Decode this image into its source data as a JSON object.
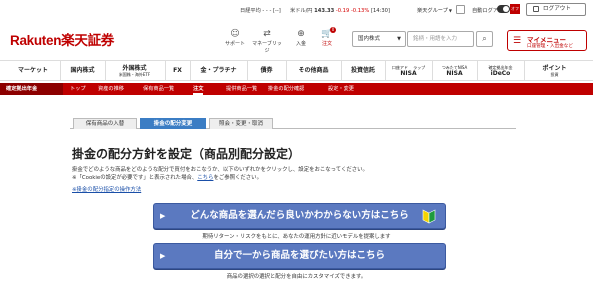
{
  "topbar": {
    "ticker": "日経平均 - - - [--]",
    "usd_label": "米ドル/円",
    "usd_value": "143.33",
    "usd_change": "-0.19",
    "usd_pct": "-0.13%",
    "usd_time": "[14:30]",
    "group": "楽天グループ",
    "autologin": "自動ログアウト",
    "toggle_label": "オフ",
    "logout": "ログアウト"
  },
  "brand": {
    "latin": "Rakuten",
    "kanji": "楽天証券"
  },
  "header_icons": [
    {
      "name": "support-icon",
      "glyph": "☺",
      "label": "サポート"
    },
    {
      "name": "bridge-icon",
      "glyph": "⇄",
      "label": "マネーブリッジ"
    },
    {
      "name": "deposit-icon",
      "glyph": "⊕",
      "label": "入金"
    },
    {
      "name": "cart-icon",
      "glyph": "🛒",
      "label": "注文",
      "badge": "0"
    }
  ],
  "search": {
    "category": "国内株式",
    "placeholder": "銘柄・用語を入力"
  },
  "mymenu": {
    "title": "マイメニュー",
    "subtitle": "口座管理・入出金など"
  },
  "global_nav": [
    {
      "label": "マーケット"
    },
    {
      "label": "国内株式"
    },
    {
      "label": "外国株式",
      "sub": "米国株・海外ETF"
    },
    {
      "label": "FX"
    },
    {
      "label": "金・プラチナ"
    },
    {
      "label": "債券"
    },
    {
      "label": "その他商品"
    },
    {
      "label": "投資信託"
    },
    {
      "label": "NISA",
      "sub": "口座アド 　ラップ"
    },
    {
      "label": "NISA",
      "sub": "つみたてNISA"
    },
    {
      "label": "iDeCo",
      "sub": "確定拠出年金"
    },
    {
      "label": "ポイント",
      "sub2": "投資"
    }
  ],
  "subnav": {
    "title": "確定拠出年金",
    "items": [
      "トップ",
      "資産の推移",
      "保有商品一覧",
      "注文",
      "提供商品一覧",
      "掛金の配分確認",
      "設定・変更"
    ]
  },
  "steps": [
    "保有商品の入替",
    "掛金の配分変更",
    "照会・変更・取消"
  ],
  "main": {
    "heading": "掛金の配分方針を設定（商品別配分設定）",
    "desc1": "掛金でどのような商品をどのような配分で買付をおこなうか、以下のいずれかをクリックし、設定をおこなってください。",
    "desc2_pre": "※「Cookieの設定が必要です」と表示された場合、",
    "desc2_link": "こちら",
    "desc2_post": "をご参照ください。",
    "guide_link": "※掛金の配分指定の操作方法",
    "btn1": "どんな商品を選んだら良いかわからない方はこちら",
    "caption1": "期待リターン・リスクをもとに、あなたの運用方針に近いモデルを提案します",
    "btn2": "自分で一から商品を選びたい方はこちら",
    "caption2": "商品の選択の選択と配分を自由にカスタマイズできます。"
  },
  "colors": {
    "brand_red": "#bf0000",
    "button_blue": "#5b79c0",
    "step_active": "#3b7dc4"
  }
}
